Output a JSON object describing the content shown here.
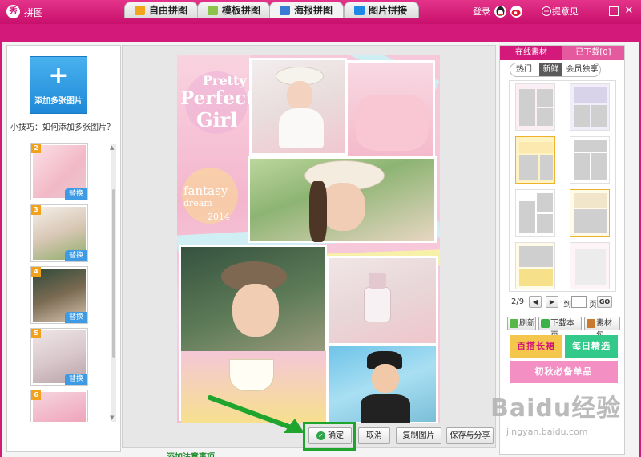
{
  "window": {
    "app_logo": "秀",
    "title": "拼图",
    "login": "登录",
    "feedback": "提意见"
  },
  "tabs": [
    {
      "label": "自由拼图",
      "icon": "free-collage-icon",
      "color": "#f2a51b"
    },
    {
      "label": "模板拼图",
      "icon": "template-collage-icon",
      "color": "#8bc34a"
    },
    {
      "label": "海报拼图",
      "icon": "poster-collage-icon",
      "color": "#3a7bd5",
      "active": true
    },
    {
      "label": "图片拼接",
      "icon": "image-join-icon",
      "color": "#1e88e5"
    }
  ],
  "left": {
    "add_button_label": "添加多张图片",
    "tip": "小技巧：如何添加多张图片？",
    "thumbnails": [
      {
        "num": "2",
        "replace": "替换"
      },
      {
        "num": "3",
        "replace": "替换"
      },
      {
        "num": "4",
        "replace": "替换"
      },
      {
        "num": "5",
        "replace": "替换"
      },
      {
        "num": "6",
        "replace": ""
      }
    ]
  },
  "poster": {
    "pretty": "Pretty",
    "perfect": "Perfect",
    "girl": "Girl",
    "fantasy": "fantasy",
    "dream": "dream",
    "year": "2014"
  },
  "bottom": {
    "confirm": "确定",
    "cancel": "取消",
    "copy": "复制图片",
    "save_share": "保存与分享"
  },
  "right": {
    "tab_online": "在线素材",
    "tab_downloaded": "已下载[0]",
    "filters": [
      "热门",
      "新鲜",
      "会员独享"
    ],
    "page_indicator": "2/9",
    "goto_label": "到",
    "page_label": "页",
    "go": "GO",
    "refresh": "刷新",
    "download_page": "下载本页",
    "material_pack": "素材包",
    "promo1": "百搭长裙",
    "promo2": "每日精选",
    "promo3": "初秋必备单品"
  },
  "colors": {
    "brand": "#d31a7b",
    "confirm_highlight": "#1fa52e",
    "add_button": "#2b97e2"
  },
  "watermark": {
    "text": "Baidu经验",
    "url": "jingyan.baidu.com"
  },
  "bottom_strip": "添加注意事项"
}
